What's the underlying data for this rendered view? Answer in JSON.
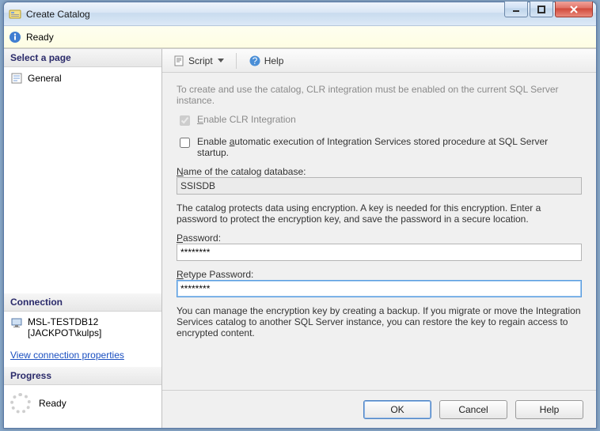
{
  "window": {
    "title": "Create Catalog"
  },
  "status": {
    "text": "Ready"
  },
  "left": {
    "select_page": "Select a page",
    "general": "General",
    "connection": "Connection",
    "server": "MSL-TESTDB12",
    "user": "[JACKPOT\\kulps]",
    "view_conn": "View connection properties",
    "progress": "Progress",
    "ready": "Ready"
  },
  "toolbar": {
    "script": "Script",
    "help": "Help"
  },
  "content": {
    "intro": "To create and use the catalog, CLR integration must be enabled on the current SQL Server instance.",
    "enable_clr": "Enable CLR Integration",
    "auto_exec": "Enable automatic execution of Integration Services stored procedure at SQL Server startup.",
    "db_name_label_pre": "N",
    "db_name_label_rest": "ame of the catalog database:",
    "db_name_value": "SSISDB",
    "protect_text": "The catalog protects data using encryption. A key is needed for this encryption. Enter a password to protect the encryption key, and save the password in a secure location.",
    "password_label_pre": "P",
    "password_label_rest": "assword:",
    "password_value": "********",
    "retype_label_pre": "R",
    "retype_label_rest": "etype Password:",
    "retype_value": "********",
    "manage_text": "You can manage the encryption key by creating a backup. If you migrate or move the Integration Services catalog to another SQL Server instance, you can restore the key to regain access to encrypted content."
  },
  "footer": {
    "ok": "OK",
    "cancel": "Cancel",
    "help": "Help"
  }
}
